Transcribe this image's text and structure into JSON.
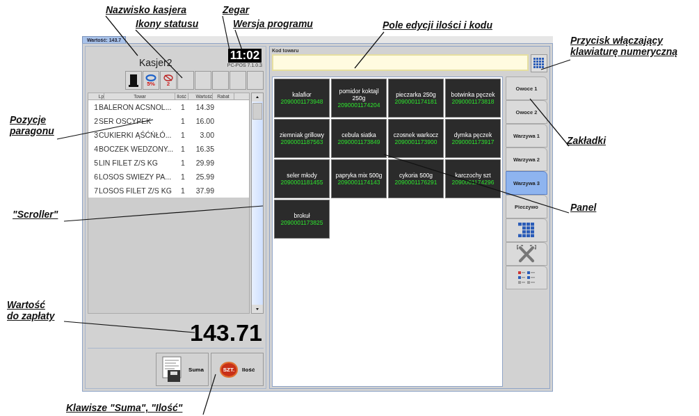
{
  "annotations": [
    {
      "lines": [
        "Nazwisko kasjera"
      ]
    },
    {
      "lines": [
        "Ikony statusu"
      ]
    },
    {
      "lines": [
        "Zegar"
      ]
    },
    {
      "lines": [
        "Wersja programu"
      ]
    },
    {
      "lines": [
        "Pole edycji ilości i kodu"
      ]
    },
    {
      "lines": [
        "Przycisk włączający",
        "klawiaturę numeryczną"
      ]
    },
    {
      "lines": [
        "Pozycje",
        "paragonu"
      ]
    },
    {
      "lines": [
        "\"Scroller\""
      ]
    },
    {
      "lines": [
        "Zakładki"
      ]
    },
    {
      "lines": [
        "Panel"
      ]
    },
    {
      "lines": [
        "Wartość",
        "do zapłaty"
      ]
    },
    {
      "lines": [
        "Klawisze \"Suma\", \"Ilość\""
      ]
    }
  ],
  "window": {
    "tab": "Wartość: 143.7"
  },
  "cashier": {
    "name": "Kasjer2",
    "clock": "11:02",
    "version": "PC-POS 7.1.0.3"
  },
  "status_icons": [
    {
      "kind": "hat"
    },
    {
      "kind": "discount",
      "label": "5%"
    },
    {
      "kind": "alert",
      "label": "2"
    },
    {
      "kind": "empty"
    },
    {
      "kind": "empty"
    },
    {
      "kind": "empty"
    },
    {
      "kind": "empty"
    },
    {
      "kind": "empty"
    }
  ],
  "receipt": {
    "columns": [
      "Lp",
      "Towar",
      "Ilość",
      "Wartość",
      "Rabat"
    ],
    "rows": [
      {
        "lp": "1",
        "item": "BALERON ACSNOL...",
        "qty": "1",
        "value": "14.39"
      },
      {
        "lp": "2",
        "item": "SER OSCYPEK",
        "qty": "1",
        "value": "16.00"
      },
      {
        "lp": "3",
        "item": "CUKIERKI ĄŚĆŃŁÓ...",
        "qty": "1",
        "value": "3.00"
      },
      {
        "lp": "4",
        "item": "BOCZEK WEDZONY...",
        "qty": "1",
        "value": "16.35"
      },
      {
        "lp": "5",
        "item": "LIN FILET Z/S KG",
        "qty": "1",
        "value": "29.99"
      },
      {
        "lp": "6",
        "item": "LOSOS SWIEZY PA...",
        "qty": "1",
        "value": "25.99"
      },
      {
        "lp": "7",
        "item": "LOSOS FILET Z/S KG",
        "qty": "1",
        "value": "37.99"
      }
    ]
  },
  "total": "143.71",
  "buttons": [
    {
      "kind": "sum",
      "label": "Suma"
    },
    {
      "kind": "quantity",
      "label": "Ilość",
      "icon_label": "SZT."
    }
  ],
  "code_field": {
    "label": "Kod towaru"
  },
  "products": [
    {
      "name": "kalafior",
      "code": "2090001173948"
    },
    {
      "name": "pomidor koktajl 250g",
      "code": "2090001174204"
    },
    {
      "name": "pieczarka 250g",
      "code": "2090001174181"
    },
    {
      "name": "botwinka pęczek",
      "code": "2090001173818"
    },
    {
      "name": "ziemniak grillowy",
      "code": "2090001187563"
    },
    {
      "name": "cebula siatka",
      "code": "2090001173849"
    },
    {
      "name": "czosnek warkocz",
      "code": "2090001173900"
    },
    {
      "name": "dymka pęczek",
      "code": "2090001173917"
    },
    {
      "name": "seler młody",
      "code": "2090001181455"
    },
    {
      "name": "papryka mix 500g",
      "code": "2090001174143"
    },
    {
      "name": "cykoria 500g",
      "code": "2090001176291"
    },
    {
      "name": "karczochy szt",
      "code": "2090001174296"
    },
    {
      "name": "brokuł",
      "code": "2090001173825"
    }
  ],
  "category_tabs": [
    {
      "kind": "text",
      "label": "Owoce 1",
      "selected": false
    },
    {
      "kind": "text",
      "label": "Owoce 2",
      "selected": false
    },
    {
      "kind": "text",
      "label": "Warzywa 1",
      "selected": false
    },
    {
      "kind": "text",
      "label": "Warzywa 2",
      "selected": false
    },
    {
      "kind": "text",
      "label": "Warzywa 3",
      "selected": true
    },
    {
      "kind": "text",
      "label": "Pieczywo",
      "selected": false
    },
    {
      "kind": "keypad",
      "selected": false
    },
    {
      "kind": "tools",
      "selected": false
    },
    {
      "kind": "options",
      "selected": false
    }
  ]
}
